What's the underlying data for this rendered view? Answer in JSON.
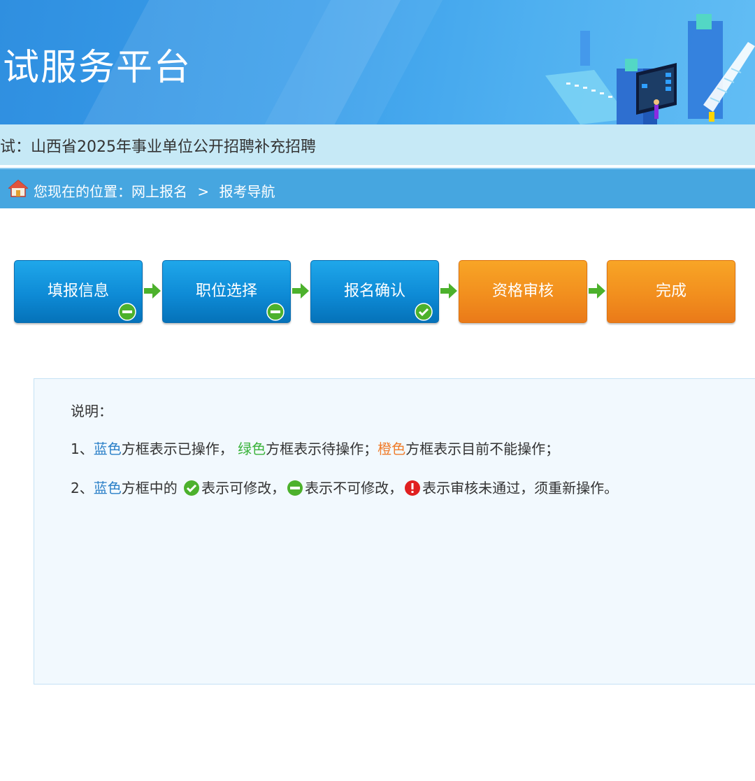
{
  "header": {
    "title": "试服务平台"
  },
  "exam": {
    "text": "试：山西省2025年事业单位公开招聘补充招聘"
  },
  "breadcrumb": {
    "prefix": "您现在的位置：",
    "item1": "网上报名",
    "separator": ">",
    "item2": "报考导航"
  },
  "steps": [
    {
      "label": "填报信息",
      "color": "blue",
      "badge": "minus-icon"
    },
    {
      "label": "职位选择",
      "color": "blue",
      "badge": "minus-icon"
    },
    {
      "label": "报名确认",
      "color": "blue",
      "badge": "check-icon"
    },
    {
      "label": "资格审核",
      "color": "orange",
      "badge": null
    },
    {
      "label": "完成",
      "color": "orange",
      "badge": null
    }
  ],
  "legend": {
    "title": "说明：",
    "line1": {
      "num": "1、",
      "blue": "蓝色",
      "t1": "方框表示已操作，",
      "green": "绿色",
      "t2": "方框表示待操作；",
      "orange": "橙色",
      "t3": "方框表示目前不能操作；"
    },
    "line2": {
      "num": "2、",
      "blue": "蓝色",
      "t1": "方框中的",
      "t2": "表示可修改，",
      "t3": "表示不可修改，",
      "t4": "表示审核未通过，须重新操作。"
    }
  },
  "colors": {
    "blue_step": "#0e8bd6",
    "orange_step": "#f28f1e",
    "badge_green": "#4cb12c",
    "error_red": "#e02020"
  }
}
